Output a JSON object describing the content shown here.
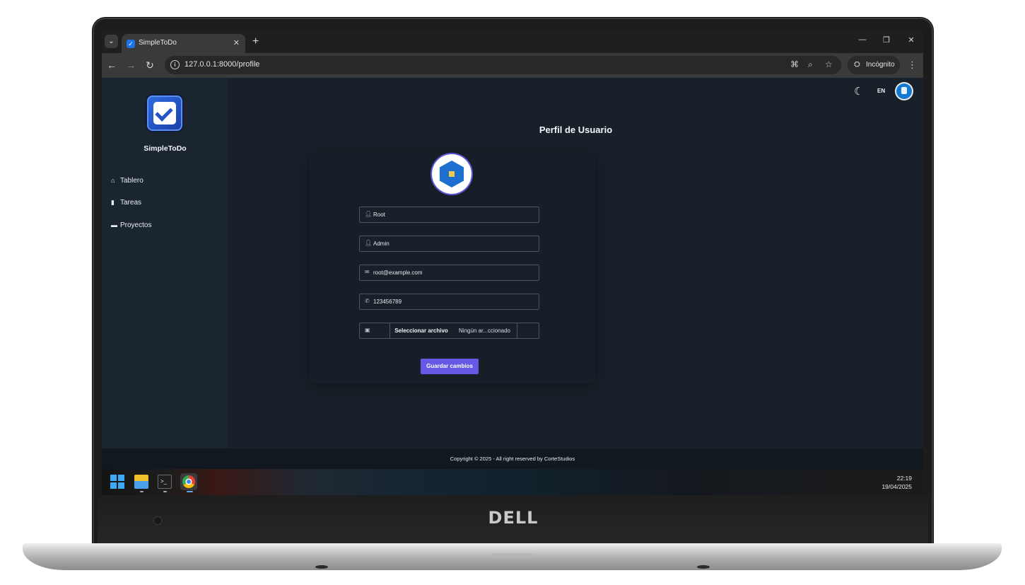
{
  "browser": {
    "tab_title": "SimpleToDo",
    "url": "127.0.0.1:8000/profile",
    "incognito_label": "Incógnito"
  },
  "sidebar": {
    "brand": "SimpleToDo",
    "items": [
      {
        "label": "Tablero",
        "icon": "home-icon"
      },
      {
        "label": "Tareas",
        "icon": "clipboard-icon"
      },
      {
        "label": "Proyectos",
        "icon": "folder-icon"
      }
    ]
  },
  "topbar": {
    "language": "EN"
  },
  "profile": {
    "title": "Perfil de Usuario",
    "first_name": "Root",
    "last_name": "Admin",
    "email": "root@example.com",
    "phone": "123456789",
    "file_button": "Seleccionar archivo",
    "file_status": "Ningún ar...ccionado",
    "save_button": "Guardar cambios"
  },
  "footer": {
    "text": "Copyright © 2025 - All right reserved by CorteStudios"
  },
  "taskbar": {
    "time": "22:19",
    "date": "19/04/2025"
  },
  "hardware": {
    "brand_logo": "DELL"
  },
  "colors": {
    "accent": "#6559e6",
    "sidebar_bg": "#1b2530",
    "main_bg": "#182029"
  }
}
